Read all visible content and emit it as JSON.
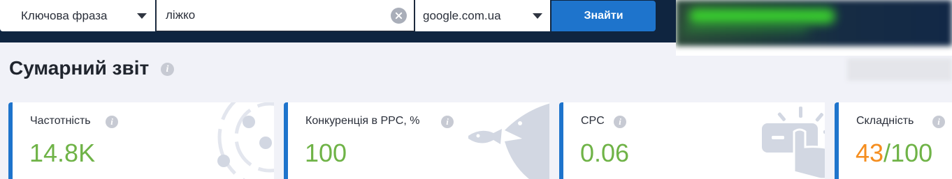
{
  "search": {
    "type_label": "Ключова фраза",
    "query_value": "ліжко",
    "domain": "google.com.ua",
    "find_label": "Знайти"
  },
  "page": {
    "title": "Сумарний звіт"
  },
  "cards": [
    {
      "label": "Частотність",
      "value": "14.8K",
      "icon": "orbit-icon"
    },
    {
      "label": "Конкуренція в PPC, %",
      "value": "100",
      "icon": "fish-icon"
    },
    {
      "label": "CPC",
      "value": "0.06",
      "icon": "click-icon"
    },
    {
      "label": "Складність",
      "value": "43",
      "value_suffix": "/100"
    }
  ],
  "colors": {
    "accent": "#1e74cc",
    "value_green": "#6fb347",
    "value_orange": "#f58e1f",
    "header_bg": "#0f2540"
  }
}
